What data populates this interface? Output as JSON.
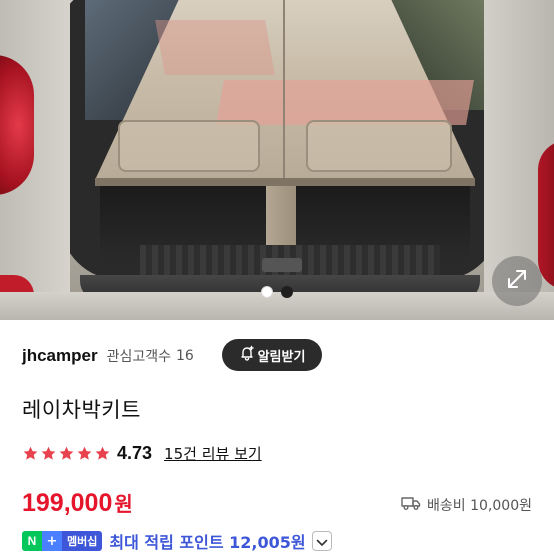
{
  "product_image": {
    "alt_icon": "expand-icon",
    "slides": [
      {
        "active": false
      },
      {
        "active": true
      }
    ]
  },
  "seller": {
    "name": "jhcamper",
    "followers_label": "관심고객수",
    "followers_count": "16",
    "alarm_button": "알림받기",
    "alarm_icon": "bell-plus-icon"
  },
  "product": {
    "title": "레이차박키트",
    "rating": {
      "stars": 5,
      "value": "4.73",
      "review_link": "15건 리뷰 보기",
      "star_color": "#e8424e"
    },
    "price": {
      "value": "199,000",
      "unit": "원",
      "color": "#e5162b"
    },
    "shipping": {
      "icon": "delivery-truck-icon",
      "text": "배송비 10,000원"
    },
    "points": {
      "badge_n": "N",
      "badge_plus": "+",
      "badge_member": "멤버십",
      "text": "최대 적립 포인트 12,005원",
      "color": "#3d57d8"
    }
  },
  "colors": {
    "npay_green": "#03c75a",
    "accent_blue": "#3d57d8",
    "price_red": "#e5162b"
  }
}
